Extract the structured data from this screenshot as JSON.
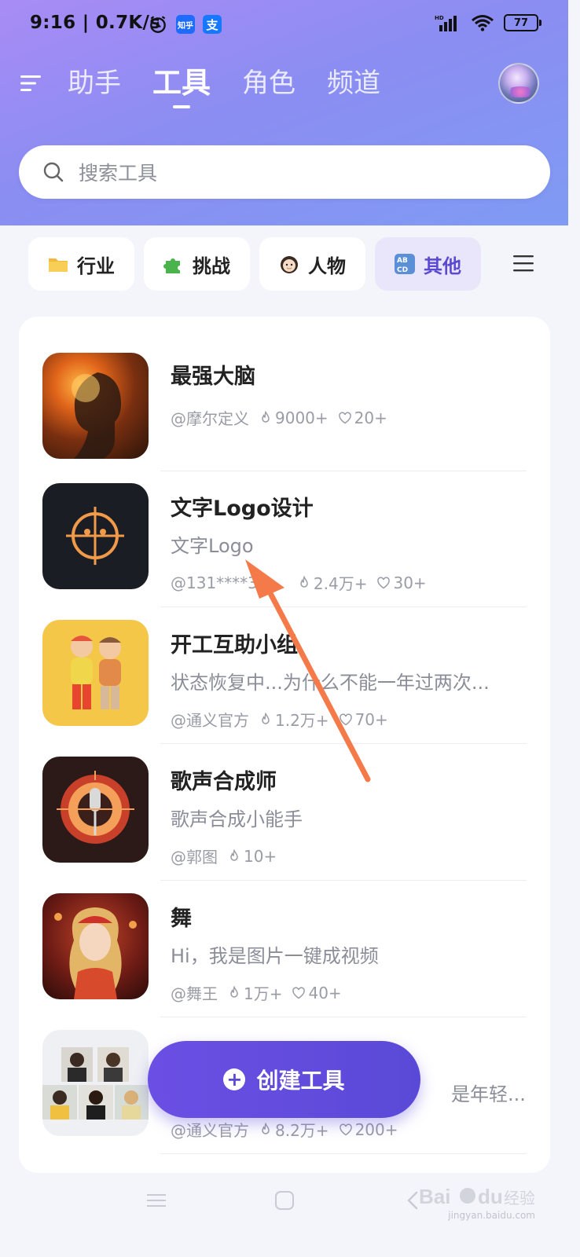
{
  "status_bar": {
    "time": "9:16 | 0.7K/s",
    "app_badges": [
      "知乎",
      "支"
    ],
    "battery": "77"
  },
  "nav": {
    "tabs": [
      "助手",
      "工具",
      "角色",
      "频道"
    ],
    "active_tab": "工具"
  },
  "search": {
    "placeholder": "搜索工具"
  },
  "categories": [
    {
      "label": "行业",
      "icon": "folder-icon"
    },
    {
      "label": "挑战",
      "icon": "puzzle-icon"
    },
    {
      "label": "人物",
      "icon": "person-icon"
    },
    {
      "label": "其他",
      "icon": "abcd-icon",
      "active": true
    }
  ],
  "tools": [
    {
      "title": "最强大脑",
      "subtitle": "",
      "author": "@摩尔定义",
      "views": "9000+",
      "likes": "20+"
    },
    {
      "title": "文字Logo设计",
      "subtitle": "文字Logo",
      "author": "@131****3",
      "views": "2.4万+",
      "likes": "30+"
    },
    {
      "title": "开工互助小组",
      "subtitle": "状态恢复中...为什么不能一年过两次...",
      "author": "@通义官方",
      "views": "1.2万+",
      "likes": "70+"
    },
    {
      "title": "歌声合成师",
      "subtitle": "歌声合成小能手",
      "author": "@郭图",
      "views": "10+",
      "likes": ""
    },
    {
      "title": "舞",
      "subtitle": "Hi，我是图片一键成视频",
      "author": "@舞王",
      "views": "1万+",
      "likes": "40+"
    },
    {
      "title": "",
      "subtitle": "是年轻...",
      "author": "@通义官方",
      "views": "8.2万+",
      "likes": "200+"
    }
  ],
  "fab": {
    "label": "创建工具"
  },
  "watermark": {
    "text": "jingyan.baidu.com"
  },
  "colors": {
    "accent": "#5a49d7",
    "header_gradient_start": "#a88cf5",
    "header_gradient_end": "#7f9bf3",
    "annotation_arrow": "#f47a4a"
  }
}
